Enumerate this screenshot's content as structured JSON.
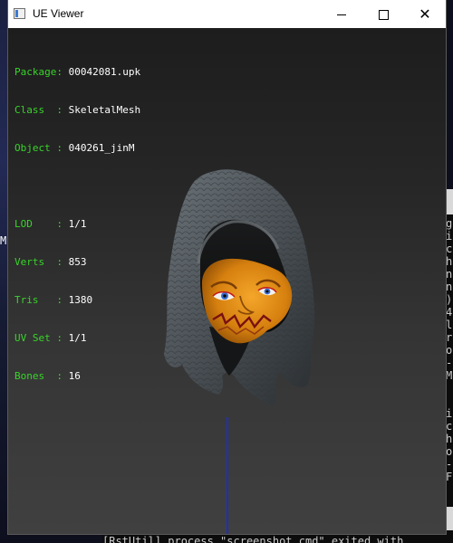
{
  "window": {
    "title": "UE Viewer",
    "controls": {
      "minimize": "minimize",
      "maximize": "maximize",
      "close": "close"
    }
  },
  "info": {
    "package_key": "Package:",
    "package_val": "00042081.upk",
    "class_key": "Class  :",
    "class_val": "SkeletalMesh",
    "object_key": "Object :",
    "object_val": "040261_jinM",
    "lod_key": "LOD    :",
    "lod_val": "1/1",
    "verts_key": "Verts  :",
    "verts_val": "853",
    "tris_key": "Tris   :",
    "tris_val": "1380",
    "uvset_key": "UV Set :",
    "uvset_val": "1/1",
    "bones_key": "Bones  :",
    "bones_val": "16"
  },
  "background": {
    "desktop_glyph": "M",
    "console_bottom": "[RstUtil] process \"screenshot.cmd\" exited with",
    "console_chars": [
      "g",
      "i",
      "c",
      "h",
      "n",
      "n",
      ")",
      "4",
      "l",
      "r",
      "o",
      "-",
      "M",
      "i",
      "c",
      "h",
      "o",
      "-",
      "F",
      "i"
    ]
  },
  "colors": {
    "info_key": "#39d42a",
    "info_value": "#ffffff",
    "viewport_top": "#1d1d1d",
    "viewport_bottom": "#404040",
    "hood": "#4a5055",
    "mask": "#e08a14"
  },
  "icons": {
    "app": "ue-viewer-app-icon"
  }
}
